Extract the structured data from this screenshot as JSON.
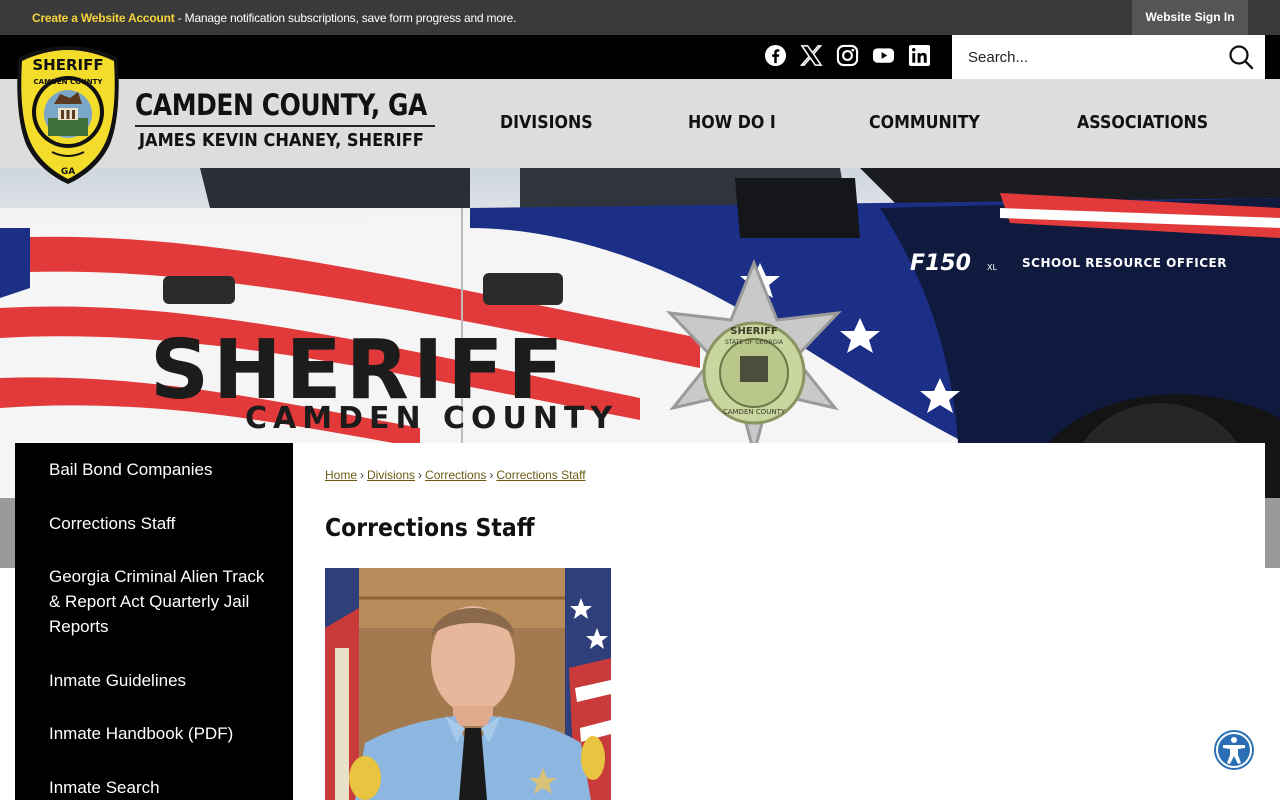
{
  "topbar": {
    "create_account_link": "Create a Website Account",
    "message": " - Manage notification subscriptions, save form progress and more.",
    "sign_in": "Website Sign In"
  },
  "social": {
    "icons": [
      "facebook-icon",
      "x-icon",
      "instagram-icon",
      "youtube-icon",
      "linkedin-icon"
    ]
  },
  "search": {
    "placeholder": "Search..."
  },
  "header": {
    "title": "CAMDEN COUNTY, GA",
    "subtitle": "JAMES KEVIN CHANEY, SHERIFF",
    "badge": {
      "top_text": "SHERIFF",
      "ring_text": "CAMDEN COUNTY",
      "bottom_text": "GA"
    }
  },
  "nav": {
    "items": [
      "DIVISIONS",
      "HOW DO I",
      "COMMUNITY",
      "ASSOCIATIONS"
    ]
  },
  "hero": {
    "truck_brand": "F150",
    "truck_badge": "XL",
    "door_text": "SCHOOL RESOURCE OFFICER",
    "main_text": "SHERIFF",
    "sub_text": "CAMDEN COUNTY",
    "star_top": "SHERIFF",
    "star_ring": "STATE OF GEORGIA",
    "star_bottom": "CAMDEN COUNTY"
  },
  "sidebar": {
    "items": [
      "Bail Bond Companies",
      "Corrections Staff",
      "Georgia Criminal Alien Track & Report Act Quarterly Jail Reports",
      "Inmate Guidelines",
      "Inmate Handbook (PDF)",
      "Inmate Search"
    ]
  },
  "breadcrumb": {
    "items": [
      "Home",
      "Divisions",
      "Corrections",
      "Corrections Staff"
    ],
    "separator": "›"
  },
  "page": {
    "title": "Corrections Staff"
  },
  "colors": {
    "topbar_bg": "#3a3a3a",
    "accent_yellow": "#f5d43a",
    "header_bg": "#dddddd",
    "sidebar_bg": "#000000",
    "link_color": "#6b5a12",
    "a11y_blue": "#2a6fb5"
  }
}
